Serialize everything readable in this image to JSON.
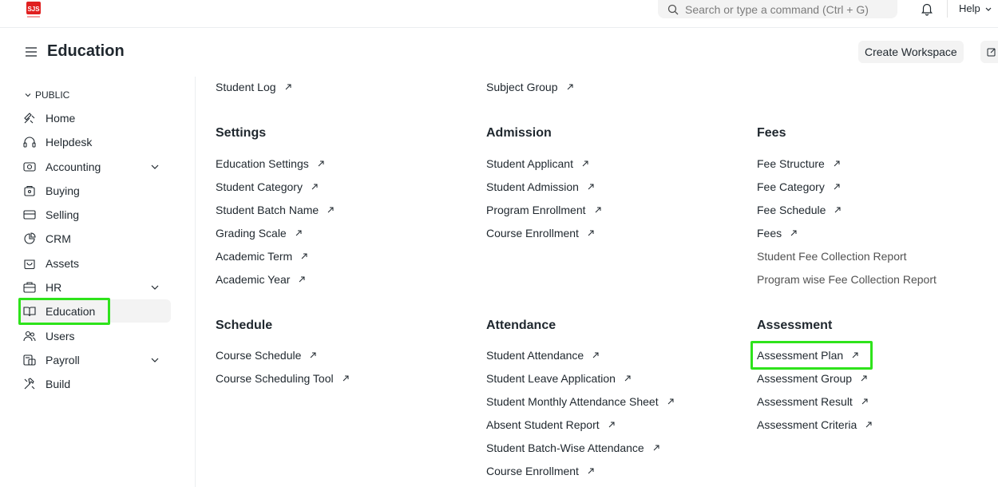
{
  "app": {
    "search_placeholder": "Search or type a command (Ctrl + G)",
    "help_label": "Help"
  },
  "header": {
    "title": "Education",
    "create_workspace": "Create Workspace"
  },
  "sidebar": {
    "section": "PUBLIC",
    "items": [
      {
        "label": "Home",
        "icon": "home-icon"
      },
      {
        "label": "Helpdesk",
        "icon": "headset-icon"
      },
      {
        "label": "Accounting",
        "icon": "accounting-icon",
        "expandable": true
      },
      {
        "label": "Buying",
        "icon": "buying-icon"
      },
      {
        "label": "Selling",
        "icon": "selling-icon"
      },
      {
        "label": "CRM",
        "icon": "crm-icon"
      },
      {
        "label": "Assets",
        "icon": "assets-icon"
      },
      {
        "label": "HR",
        "icon": "hr-icon",
        "expandable": true
      },
      {
        "label": "Education",
        "icon": "book-icon",
        "active": true
      },
      {
        "label": "Users",
        "icon": "users-icon"
      },
      {
        "label": "Payroll",
        "icon": "payroll-icon",
        "expandable": true
      },
      {
        "label": "Build",
        "icon": "build-icon"
      }
    ]
  },
  "main": {
    "top_links": [
      "Student Log",
      "Subject Group"
    ],
    "sections": {
      "settings": {
        "title": "Settings",
        "links": [
          "Education Settings",
          "Student Category",
          "Student Batch Name",
          "Grading Scale",
          "Academic Term",
          "Academic Year"
        ]
      },
      "admission": {
        "title": "Admission",
        "links": [
          "Student Applicant",
          "Student Admission",
          "Program Enrollment",
          "Course Enrollment"
        ]
      },
      "fees": {
        "title": "Fees",
        "links": [
          "Fee Structure",
          "Fee Category",
          "Fee Schedule",
          "Fees"
        ],
        "reports": [
          "Student Fee Collection Report",
          "Program wise Fee Collection Report"
        ]
      },
      "schedule": {
        "title": "Schedule",
        "links": [
          "Course Schedule",
          "Course Scheduling Tool"
        ]
      },
      "attendance": {
        "title": "Attendance",
        "links": [
          "Student Attendance",
          "Student Leave Application",
          "Student Monthly Attendance Sheet",
          "Absent Student Report",
          "Student Batch-Wise Attendance",
          "Course Enrollment"
        ]
      },
      "assessment": {
        "title": "Assessment",
        "links": [
          "Assessment Plan",
          "Assessment Group",
          "Assessment Result",
          "Assessment Criteria"
        ]
      }
    }
  },
  "colors": {
    "highlight": "#2ee31b",
    "logo_red": "#e02020",
    "text": "#1f272e"
  }
}
